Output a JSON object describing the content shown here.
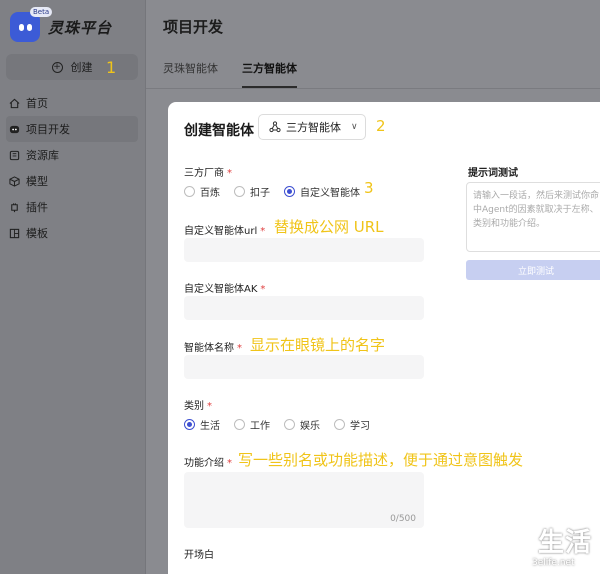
{
  "app": {
    "logo_text": "灵珠平台",
    "beta": "Beta"
  },
  "sidebar": {
    "create_label": "创建",
    "items": [
      {
        "label": "首页",
        "icon": "home-icon"
      },
      {
        "label": "项目开发",
        "icon": "project-icon"
      },
      {
        "label": "资源库",
        "icon": "library-icon"
      },
      {
        "label": "模型",
        "icon": "model-icon"
      },
      {
        "label": "插件",
        "icon": "plugin-icon"
      },
      {
        "label": "模板",
        "icon": "template-icon"
      }
    ]
  },
  "header": {
    "title": "项目开发",
    "tabs": [
      {
        "label": "灵珠智能体"
      },
      {
        "label": "三方智能体"
      }
    ]
  },
  "modal": {
    "title": "创建智能体",
    "type_select": "三方智能体",
    "vendor_label": "三方厂商",
    "vendor_options": [
      "百炼",
      "扣子",
      "自定义智能体"
    ],
    "url_label": "自定义智能体url",
    "ak_label": "自定义智能体AK",
    "name_label": "智能体名称",
    "category_label": "类别",
    "category_options": [
      "生活",
      "工作",
      "娱乐",
      "学习"
    ],
    "intro_label": "功能介绍",
    "intro_counter": "0/500",
    "opening_label": "开场白",
    "prompt_test_label": "提示词测试",
    "prompt_placeholder": "请输入一段话，然后来测试你命中Agent的因素就取决于左称、类别和功能介绍。",
    "test_button": "立即测试"
  },
  "annotations": {
    "a1": "1",
    "a2": "2",
    "a3": "3",
    "url_note": "替换成公网 URL",
    "name_note": "显示在眼镜上的名字",
    "intro_note": "写一些别名或功能描述，便于通过意图触发"
  },
  "watermark": {
    "text": "生活",
    "url": "3elife.net"
  },
  "colors": {
    "accent": "#3d4fd1",
    "annotation": "#f0c419",
    "required": "#e04040"
  }
}
